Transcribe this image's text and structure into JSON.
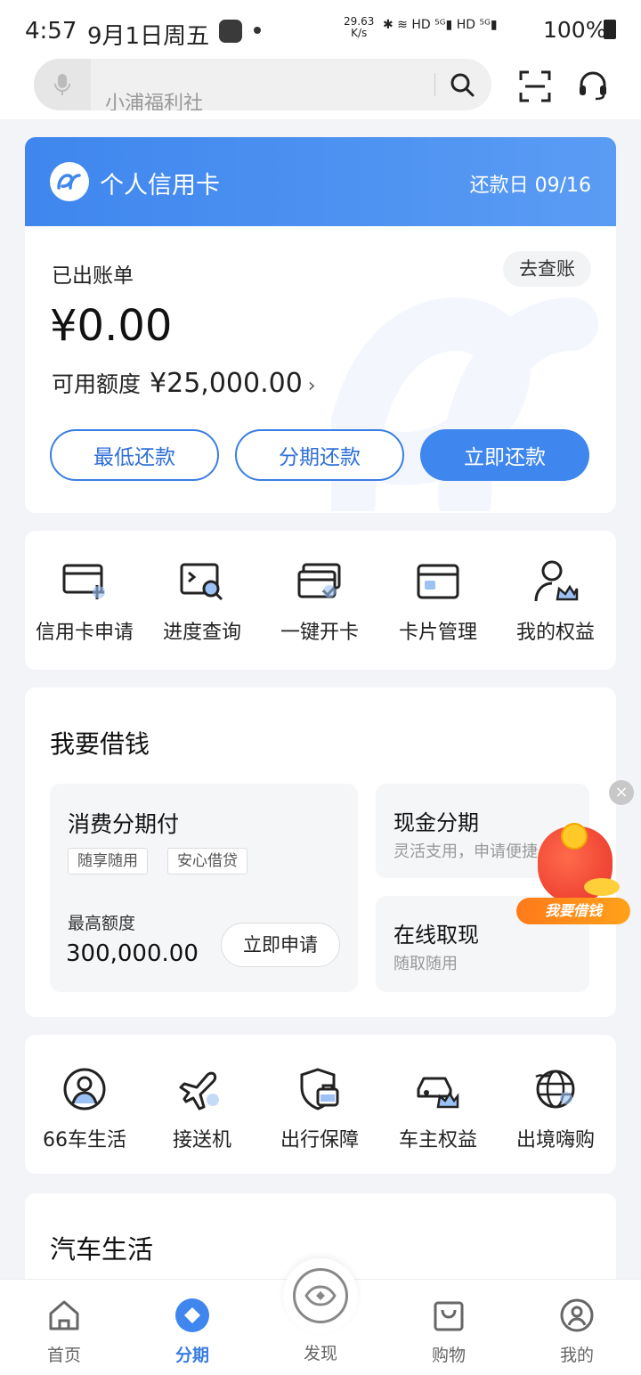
{
  "status_bar": {
    "time": "4:57",
    "date": "9月1日周五",
    "net_speed": "29.63",
    "net_unit": "K/s",
    "icons": "✱ ≋ HD ⁵ᴳ▮ HD ⁵ᴳ▮",
    "battery": "100%"
  },
  "header": {
    "search_placeholder": "小浦福利社"
  },
  "credit_card": {
    "title": "个人信用卡",
    "due_date": "还款日 09/16",
    "billed_label": "已出账单",
    "check_bill": "去查账",
    "billed_amount": "¥0.00",
    "available_label": "可用额度",
    "available_amount": "¥25,000.00",
    "available_chevron": "›",
    "buttons": [
      "最低还款",
      "分期还款",
      "立即还款"
    ]
  },
  "quick_menu": [
    {
      "label": "信用卡申请",
      "icon": "card-add-icon"
    },
    {
      "label": "进度查询",
      "icon": "progress-search-icon"
    },
    {
      "label": "一键开卡",
      "icon": "card-activate-icon"
    },
    {
      "label": "卡片管理",
      "icon": "card-manage-icon"
    },
    {
      "label": "我的权益",
      "icon": "user-crown-icon"
    }
  ],
  "borrow": {
    "title": "我要借钱",
    "consumer": {
      "title": "消费分期付",
      "tags": [
        "随享随用",
        "安心借贷"
      ],
      "limit_label": "最高额度",
      "limit": "300,000.00",
      "apply": "立即申请"
    },
    "cash": {
      "title": "现金分期",
      "subtitle": "灵活支用，申请便捷"
    },
    "withdraw": {
      "title": "在线取现",
      "subtitle": "随取随用"
    },
    "float_close": "×",
    "float_label": "我要借钱"
  },
  "services": [
    {
      "label": "66车生活",
      "icon": "car-life-icon"
    },
    {
      "label": "接送机",
      "icon": "airplane-icon"
    },
    {
      "label": "出行保障",
      "icon": "shield-bag-icon"
    },
    {
      "label": "车主权益",
      "icon": "car-crown-icon"
    },
    {
      "label": "出境嗨购",
      "icon": "globe-shopping-icon"
    }
  ],
  "car_life": {
    "title": "汽车生活"
  },
  "tabs": [
    {
      "label": "首页",
      "icon": "home-icon"
    },
    {
      "label": "分期",
      "icon": "installment-icon",
      "active": true
    },
    {
      "label": "发现",
      "icon": "eye-icon"
    },
    {
      "label": "购物",
      "icon": "shopping-bag-icon"
    },
    {
      "label": "我的",
      "icon": "user-icon"
    }
  ],
  "colors": {
    "primary": "#3f86ee",
    "accent_orange": "#ff8a1a",
    "background": "#f2f4f8"
  }
}
